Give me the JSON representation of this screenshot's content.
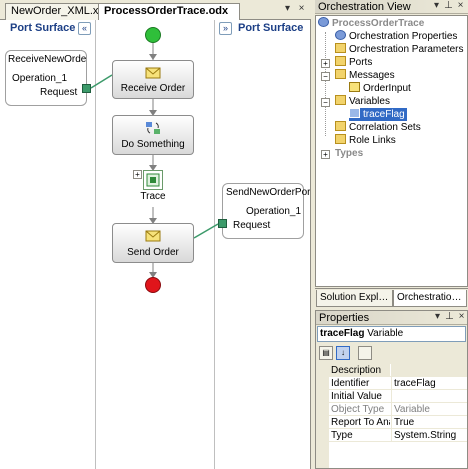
{
  "doc_tabs": [
    {
      "label": "NewOrder_XML.xsd",
      "active": false
    },
    {
      "label": "ProcessOrderTrace.odx",
      "active": true
    }
  ],
  "tab_controls": {
    "dropdown": "▾",
    "close": "×"
  },
  "designer": {
    "left_surface_title": "Port Surface",
    "right_surface_title": "Port Surface",
    "collapse_left": "«",
    "collapse_right": "»",
    "left_port": {
      "name": "ReceiveNewOrder…",
      "operation": "Operation_1",
      "message": "Request"
    },
    "right_port": {
      "name": "SendNewOrderPort",
      "operation": "Operation_1",
      "message": "Request"
    },
    "shapes": [
      {
        "label": "Receive Order",
        "icon": "envelope-icon"
      },
      {
        "label": "Do Something",
        "icon": "construct-icon"
      },
      {
        "label": "Trace",
        "icon": "expression-icon"
      },
      {
        "label": "Send Order",
        "icon": "envelope-icon"
      }
    ],
    "expand_trace": "+"
  },
  "orchestration_view": {
    "title": "Orchestration View",
    "root": "ProcessOrderTrace",
    "items": [
      {
        "label": "Orchestration Properties",
        "icon": "gear-icon"
      },
      {
        "label": "Orchestration Parameters",
        "icon": "folder-icon"
      },
      {
        "label": "Ports",
        "icon": "folder-icon",
        "expander": "+"
      },
      {
        "label": "Messages",
        "icon": "folder-icon",
        "expander": "−"
      },
      {
        "label": "OrderInput",
        "icon": "message-icon"
      },
      {
        "label": "Variables",
        "icon": "folder-icon",
        "expander": "−"
      },
      {
        "label": "traceFlag",
        "icon": "variable-icon",
        "selected": true
      },
      {
        "label": "Correlation Sets",
        "icon": "folder-icon"
      },
      {
        "label": "Role Links",
        "icon": "folder-icon"
      }
    ],
    "types": {
      "label": "Types",
      "expander": "+"
    }
  },
  "bottom_tabs": [
    {
      "label": "Solution Expl…",
      "active": false
    },
    {
      "label": "Orchestratio…",
      "active": true
    }
  ],
  "properties": {
    "title": "Properties",
    "object_name": "traceFlag",
    "object_type": "Variable",
    "rows": [
      {
        "name": "Description",
        "value": "",
        "category": true
      },
      {
        "name": "Identifier",
        "value": "traceFlag"
      },
      {
        "name": "Initial Value",
        "value": ""
      },
      {
        "name": "Object Type",
        "value": "Variable",
        "readonly": true
      },
      {
        "name": "Report To Analy",
        "value": "True"
      },
      {
        "name": "Type",
        "value": "System.String"
      }
    ]
  },
  "colors": {
    "start_shape": "#2fbf3a",
    "end_shape": "#e0151b",
    "connector": "#3c9a6a",
    "surface_title": "#1c3f86",
    "selection": "#316ac5"
  }
}
